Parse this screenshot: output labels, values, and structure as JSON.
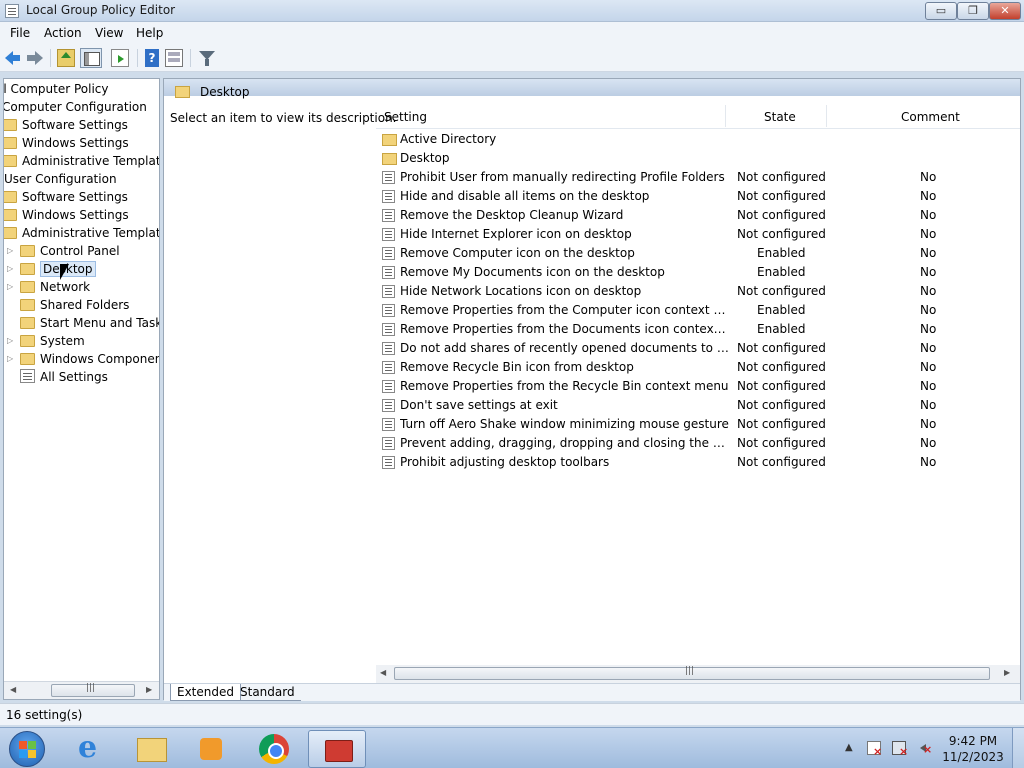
{
  "window": {
    "title": "Local Group Policy Editor",
    "min": "▭",
    "max": "❐",
    "close": "✕"
  },
  "menu": {
    "file": "File",
    "action": "Action",
    "view": "View",
    "help": "Help"
  },
  "toolbar": {
    "help_label": "?"
  },
  "tree": {
    "items": [
      {
        "label": "al Computer Policy"
      },
      {
        "label": "Computer Configuration"
      },
      {
        "label": "Software Settings"
      },
      {
        "label": "Windows Settings"
      },
      {
        "label": "Administrative Templates"
      },
      {
        "label": "User Configuration"
      },
      {
        "label": "Software Settings"
      },
      {
        "label": "Windows Settings"
      },
      {
        "label": "Administrative Templates"
      },
      {
        "label": "Control Panel"
      },
      {
        "label": "Desktop"
      },
      {
        "label": "Network"
      },
      {
        "label": "Shared Folders"
      },
      {
        "label": "Start Menu and Taskba"
      },
      {
        "label": "System"
      },
      {
        "label": "Windows Components"
      },
      {
        "label": "All Settings"
      }
    ]
  },
  "details": {
    "header": "Desktop",
    "description": "Select an item to view its description.",
    "columns": {
      "setting": "Setting",
      "state": "State",
      "comment": "Comment"
    },
    "rows": [
      {
        "name": "Active Directory",
        "state": "",
        "comment": ""
      },
      {
        "name": "Desktop",
        "state": "",
        "comment": ""
      },
      {
        "name": "Prohibit User from manually redirecting Profile Folders",
        "state": "Not configured",
        "comment": "No"
      },
      {
        "name": "Hide and disable all items on the desktop",
        "state": "Not configured",
        "comment": "No"
      },
      {
        "name": "Remove the Desktop Cleanup Wizard",
        "state": "Not configured",
        "comment": "No"
      },
      {
        "name": "Hide Internet Explorer icon on desktop",
        "state": "Not configured",
        "comment": "No"
      },
      {
        "name": "Remove Computer icon on the desktop",
        "state": "Enabled",
        "comment": "No"
      },
      {
        "name": "Remove My Documents icon on the desktop",
        "state": "Enabled",
        "comment": "No"
      },
      {
        "name": "Hide Network Locations icon on desktop",
        "state": "Not configured",
        "comment": "No"
      },
      {
        "name": "Remove Properties from the Computer icon context menu",
        "state": "Enabled",
        "comment": "No"
      },
      {
        "name": "Remove Properties from the Documents icon context menu",
        "state": "Enabled",
        "comment": "No"
      },
      {
        "name": "Do not add shares of recently opened documents to Networ...",
        "state": "Not configured",
        "comment": "No"
      },
      {
        "name": "Remove Recycle Bin icon from desktop",
        "state": "Not configured",
        "comment": "No"
      },
      {
        "name": "Remove Properties from the Recycle Bin context menu",
        "state": "Not configured",
        "comment": "No"
      },
      {
        "name": "Don't save settings at exit",
        "state": "Not configured",
        "comment": "No"
      },
      {
        "name": "Turn off Aero Shake window minimizing mouse gesture",
        "state": "Not configured",
        "comment": "No"
      },
      {
        "name": "Prevent adding, dragging, dropping and closing the Taskbar...",
        "state": "Not configured",
        "comment": "No"
      },
      {
        "name": "Prohibit adjusting desktop toolbars",
        "state": "Not configured",
        "comment": "No"
      }
    ],
    "tabs": {
      "extended": "Extended",
      "standard": "Standard"
    }
  },
  "status": {
    "text": "16 setting(s)"
  },
  "taskbar": {
    "time": "9:42 PM",
    "date": "11/2/2023",
    "tray_arrow": "▲"
  },
  "scroll": {
    "left_arrow": "◀",
    "right_arrow": "▶"
  }
}
